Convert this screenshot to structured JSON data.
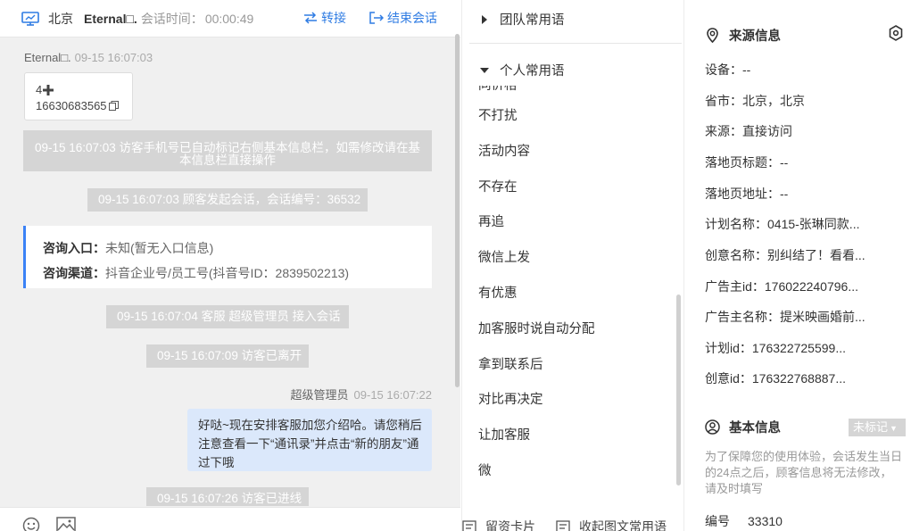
{
  "header": {
    "city": "北京",
    "visitor": "Eternal□.",
    "timer_label": "会话时间：",
    "timer": "00:00:49",
    "transfer": "转接",
    "end": "结束会话"
  },
  "messages": {
    "visitor_meta_name": "Eternal□.",
    "visitor_meta_time": "09-15 16:07:03",
    "card_line1": "4",
    "card_line2": "16630683565",
    "sys_phone": "09-15 16:07:03 访客手机号已自动标记右侧基本信息栏，如需修改请在基本信息栏直接操作",
    "sys_start": "09-15 16:07:03 顾客发起会话，会话编号：36532",
    "consult_entry_label": "咨询入口：",
    "consult_entry_value": "未知(暂无入口信息)",
    "consult_channel_label": "咨询渠道：",
    "consult_channel_value": "抖音企业号/员工号(抖音号ID：2839502213)",
    "sys_join": "09-15 16:07:04 客服 超级管理员 接入会话",
    "sys_leave": "09-15 16:07:09 访客已离开",
    "agent_name": "超级管理员",
    "agent_time": "09-15 16:07:22",
    "agent_text": "好哒~现在安排客服加您介绍哈。请您稍后注意查看一下“通讯录”并点击“新的朋友”通过下哦",
    "sys_reenter": "09-15 16:07:26 访客已进线"
  },
  "phrases": {
    "team_group": "团队常用语",
    "personal_group": "个人常用语",
    "partial_item": "同价格",
    "items": [
      "不打扰",
      "活动内容",
      "不存在",
      "再追",
      "微信上发",
      "有优惠",
      "加客服时说自动分配",
      "拿到联系后",
      "对比再决定",
      "让加客服",
      "微"
    ],
    "card_btn": "留资卡片",
    "collapse_btn": "收起图文常用语"
  },
  "source": {
    "title": "来源信息",
    "rows": [
      "设备：--",
      "省市：北京，北京",
      "来源：直接访问",
      "落地页标题：--",
      "落地页地址：--",
      "计划名称：0415-张琳同款...",
      "创意名称：别纠结了！看看...",
      "广告主id：176022240796...",
      "广告主名称：提米映画婚前...",
      "计划id：176322725599...",
      "创意id：176322768887..."
    ]
  },
  "basic": {
    "title": "基本信息",
    "tag": "未标记",
    "notice": "为了保障您的使用体验，会话发生当日的24点之后，顾客信息将无法修改，请及时填写",
    "serial_label": "编号",
    "serial_value": "33310"
  },
  "colors": {
    "accent": "#2f7ce3",
    "agent_bubble": "#dbe8fb",
    "consult_bar": "#3b82f6",
    "sys_gray": "#d5d5d5"
  }
}
